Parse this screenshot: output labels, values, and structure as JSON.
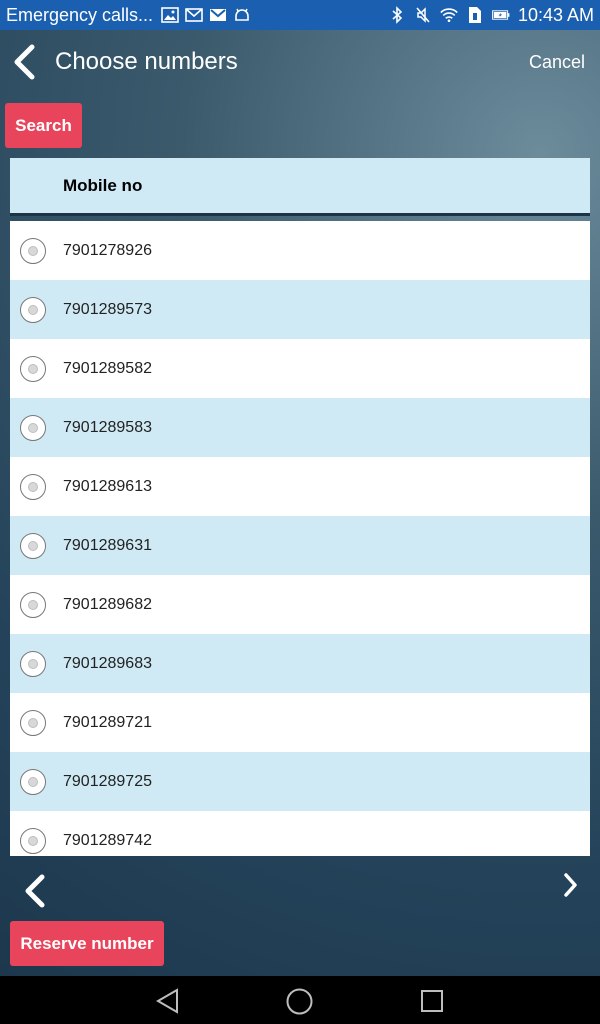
{
  "status_bar": {
    "notification_title": "Emergency calls...",
    "time": "10:43 AM",
    "left_icons": [
      "image-icon",
      "mail-icon",
      "gmail-icon",
      "android-icon"
    ],
    "right_icons": [
      "bluetooth-icon",
      "mute-icon",
      "wifi-icon",
      "sim-icon",
      "battery-icon"
    ]
  },
  "header": {
    "title": "Choose numbers",
    "cancel_label": "Cancel"
  },
  "search": {
    "label": "Search"
  },
  "table": {
    "column_header": "Mobile no",
    "rows": [
      "7901278926",
      "7901289573",
      "7901289582",
      "7901289583",
      "7901289613",
      "7901289631",
      "7901289682",
      "7901289683",
      "7901289721",
      "7901289725",
      "7901289742"
    ]
  },
  "reserve": {
    "label": "Reserve number"
  },
  "colors": {
    "status_bar": "#1b5fb0",
    "accent": "#e8455c",
    "row_alt": "#cfeaf5"
  }
}
